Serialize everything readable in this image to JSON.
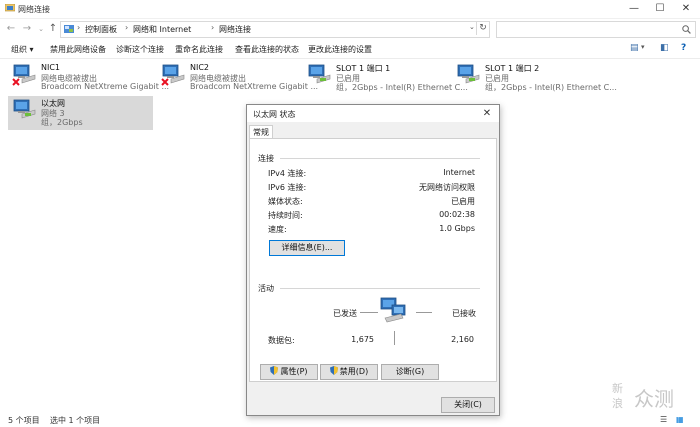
{
  "window": {
    "title": "网络连接",
    "controls": {
      "minimize": "—",
      "maximize": "☐",
      "close": "✕"
    }
  },
  "address": {
    "crumbs": [
      "控制面板",
      "网络和 Internet",
      "网络连接"
    ],
    "separator": "›",
    "refresh": "↻",
    "search_placeholder": ""
  },
  "toolbar": {
    "organize": "组织 ▾",
    "items": [
      "禁用此网络设备",
      "诊断这个连接",
      "重命名此连接",
      "查看此连接的状态",
      "更改此连接的设置"
    ]
  },
  "connections": [
    {
      "name": "NIC1",
      "status": "网络电缆被拔出",
      "device": "Broadcom NetXtreme Gigabit ...",
      "disconnected": true,
      "selected": false
    },
    {
      "name": "NIC2",
      "status": "网络电缆被拔出",
      "device": "Broadcom NetXtreme Gigabit ...",
      "disconnected": true,
      "selected": false
    },
    {
      "name": "SLOT 1 端口 1",
      "status": "已启用",
      "device": "组，2Gbps - Intel(R) Ethernet C...",
      "disconnected": false,
      "selected": false
    },
    {
      "name": "SLOT 1 端口 2",
      "status": "已启用",
      "device": "组，2Gbps - Intel(R) Ethernet C...",
      "disconnected": false,
      "selected": false
    },
    {
      "name": "以太网",
      "status": "网络 3",
      "device": "组，2Gbps",
      "disconnected": false,
      "selected": true
    }
  ],
  "statusbar": {
    "count": "5 个项目",
    "selected": "选中 1 个项目"
  },
  "dialog": {
    "title": "以太网 状态",
    "close": "✕",
    "tab": "常规",
    "connection_heading": "连接",
    "rows": [
      {
        "label": "IPv4 连接:",
        "value": "Internet"
      },
      {
        "label": "IPv6 连接:",
        "value": "无网络访问权限"
      },
      {
        "label": "媒体状态:",
        "value": "已启用"
      },
      {
        "label": "持续时间:",
        "value": "00:02:38"
      },
      {
        "label": "速度:",
        "value": "1.0 Gbps"
      }
    ],
    "details_button": "详细信息(E)...",
    "activity_heading": "活动",
    "sent_label": "已发送",
    "received_label": "已接收",
    "packets_label": "数据包:",
    "packets_sent": "1,675",
    "packets_received": "2,160",
    "properties_button": "属性(P)",
    "disable_button": "禁用(D)",
    "diagnose_button": "诊断(G)",
    "close_button": "关闭(C)"
  },
  "watermark": {
    "line1": "新",
    "line2": "浪",
    "brand": "众测"
  },
  "colors": {
    "selection": "#d9d9d9",
    "accent": "#0078d7",
    "error": "#e81123"
  }
}
